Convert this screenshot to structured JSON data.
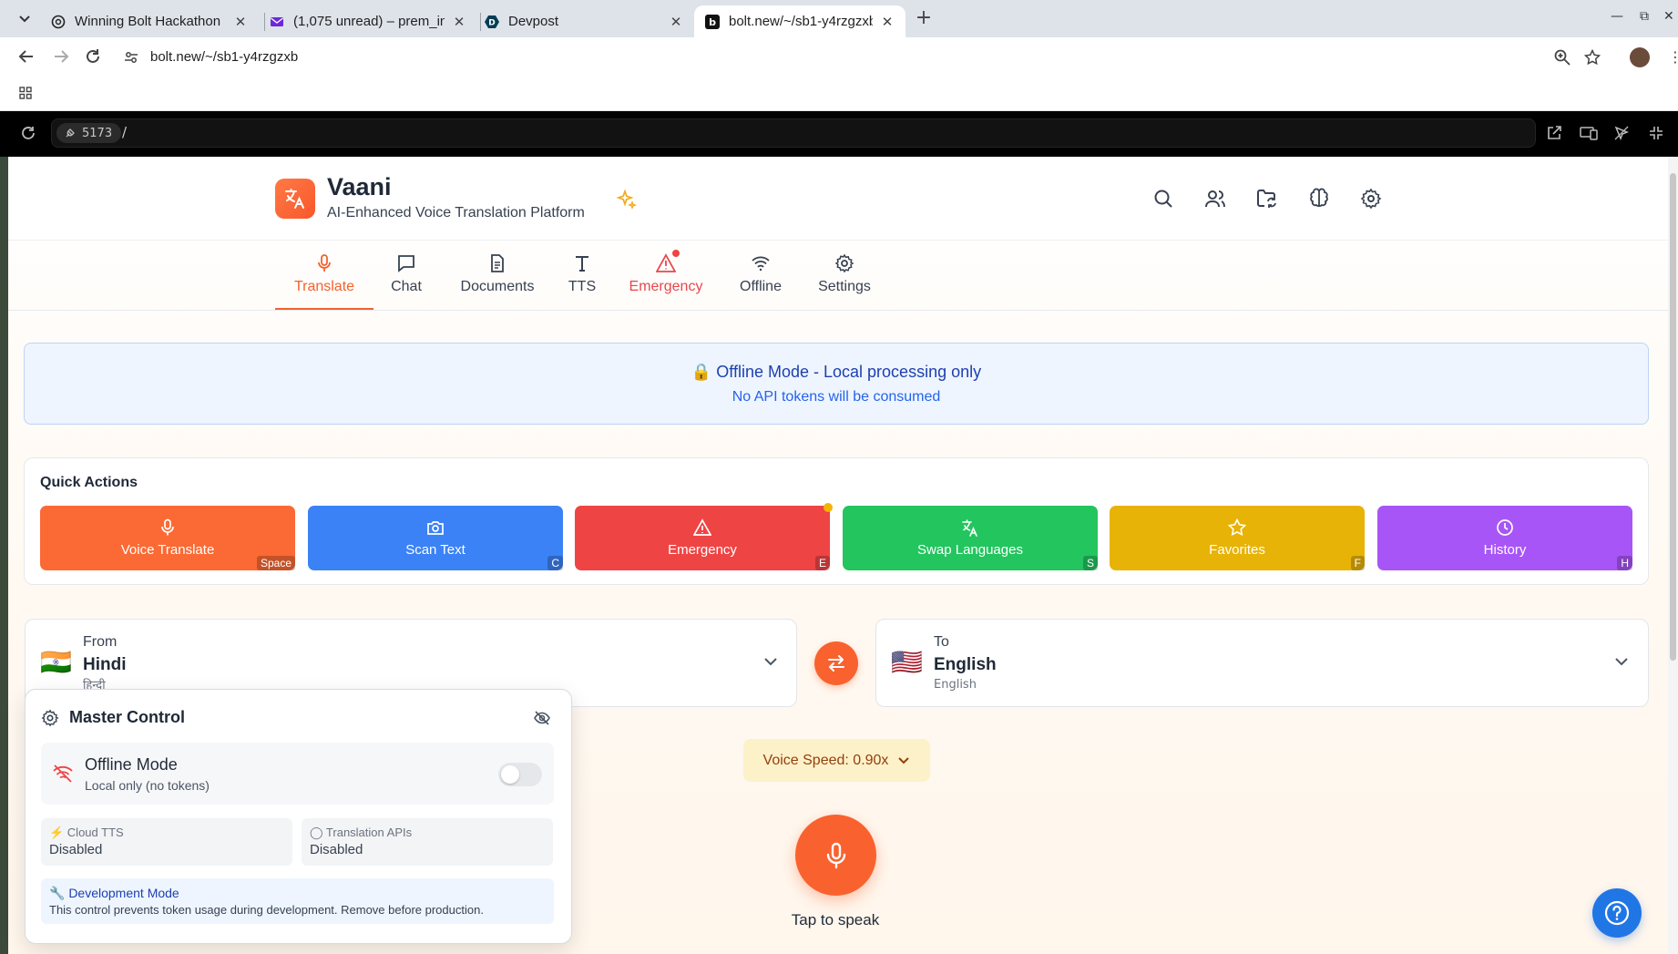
{
  "browser": {
    "tabs": [
      {
        "title": "Winning Bolt Hackathon",
        "favicon": "openai-icon"
      },
      {
        "title": "(1,075 unread) – prem_in",
        "favicon": "mail-icon"
      },
      {
        "title": "Devpost",
        "favicon": "devpost-icon"
      },
      {
        "title": "bolt.new/~/sb1-y4rzgzxb",
        "favicon": "bolt-icon"
      }
    ],
    "url": "bolt.new/~/sb1-y4rzgzxb"
  },
  "bolt": {
    "port": "5173",
    "path": "/"
  },
  "app": {
    "name": "Vaani",
    "subtitle": "AI-Enhanced Voice Translation Platform",
    "brand_color": "#f9622e"
  },
  "nav": {
    "tabs": [
      {
        "label": "Translate",
        "icon": "mic-icon",
        "active": true
      },
      {
        "label": "Chat",
        "icon": "chat-icon"
      },
      {
        "label": "Documents",
        "icon": "document-icon"
      },
      {
        "label": "TTS",
        "icon": "text-icon"
      },
      {
        "label": "Emergency",
        "icon": "warning-icon"
      },
      {
        "label": "Offline",
        "icon": "wifi-icon"
      },
      {
        "label": "Settings",
        "icon": "gear-icon"
      }
    ]
  },
  "banner": {
    "title": "🔒 Offline Mode - Local processing only",
    "subtitle": "No API tokens will be consumed"
  },
  "quick_actions": {
    "title": "Quick Actions",
    "buttons": [
      {
        "label": "Voice Translate",
        "key": "Space",
        "color": "#fb6a34",
        "icon": "mic-icon"
      },
      {
        "label": "Scan Text",
        "key": "C",
        "color": "#3b82f6",
        "icon": "camera-icon"
      },
      {
        "label": "Emergency",
        "key": "E",
        "color": "#ef4444",
        "icon": "warning-icon"
      },
      {
        "label": "Swap Languages",
        "key": "S",
        "color": "#22c55e",
        "icon": "translate-icon"
      },
      {
        "label": "Favorites",
        "key": "F",
        "color": "#e8b307",
        "icon": "star-icon"
      },
      {
        "label": "History",
        "key": "H",
        "color": "#a855f7",
        "icon": "clock-icon"
      }
    ]
  },
  "languages": {
    "from": {
      "label": "From",
      "name": "Hindi",
      "native": "हिन्दी",
      "flag": "🇮🇳"
    },
    "to": {
      "label": "To",
      "name": "English",
      "native": "English",
      "flag": "🇺🇸"
    }
  },
  "voice_speed": "Voice Speed: 0.90x",
  "mic": {
    "label": "Tap to speak"
  },
  "master_control": {
    "title": "Master Control",
    "offline": {
      "title": "Offline Mode",
      "subtitle": "Local only (no tokens)",
      "enabled": false
    },
    "cloud_tts": {
      "label": "⚡ Cloud TTS",
      "value": "Disabled"
    },
    "translation_apis": {
      "label": "◯ Translation APIs",
      "value": "Disabled"
    },
    "dev": {
      "title": "🔧 Development Mode",
      "text": "This control prevents token usage during development. Remove before production."
    }
  }
}
